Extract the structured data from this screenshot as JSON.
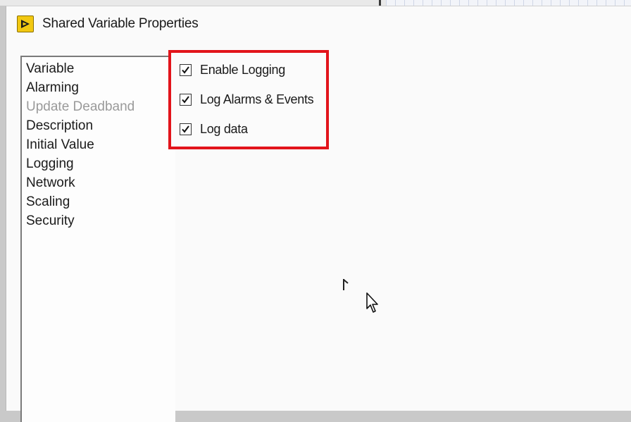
{
  "dialog": {
    "title": "Shared Variable Properties",
    "icon": "labview-run-icon"
  },
  "sidebar": {
    "items": [
      {
        "label": "Variable",
        "enabled": true
      },
      {
        "label": "Alarming",
        "enabled": true
      },
      {
        "label": "Update Deadband",
        "enabled": false
      },
      {
        "label": "Description",
        "enabled": true
      },
      {
        "label": "Initial Value",
        "enabled": true
      },
      {
        "label": "Logging",
        "enabled": true
      },
      {
        "label": "Network",
        "enabled": true
      },
      {
        "label": "Scaling",
        "enabled": true
      },
      {
        "label": "Security",
        "enabled": true
      }
    ]
  },
  "logging": {
    "options": [
      {
        "label": "Enable Logging",
        "checked": true
      },
      {
        "label": "Log Alarms & Events",
        "checked": true
      },
      {
        "label": "Log data",
        "checked": true
      }
    ]
  },
  "colors": {
    "highlight_border": "#e2141b",
    "icon_fill": "#f2c811"
  }
}
